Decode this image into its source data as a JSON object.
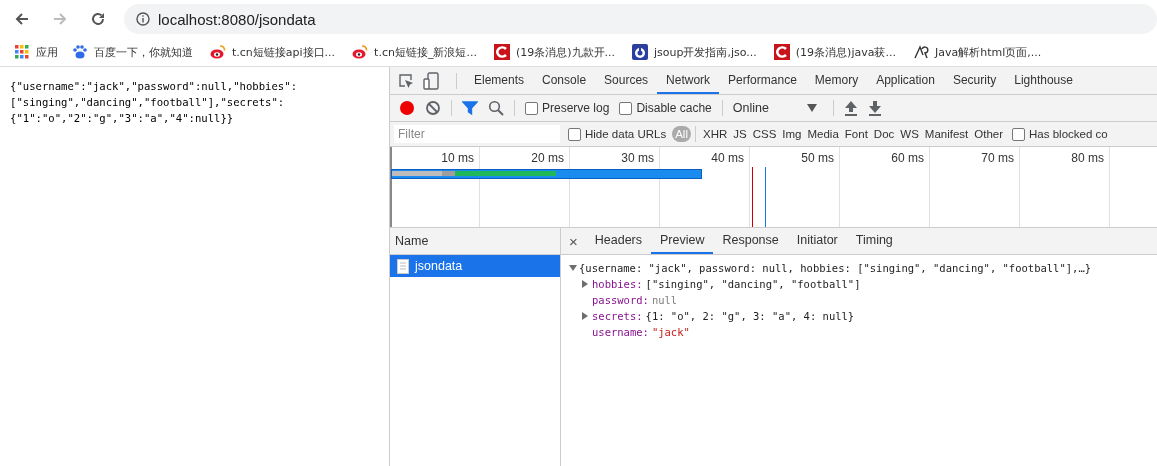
{
  "browser": {
    "address": "localhost:8080/jsondata",
    "back_disabled": false,
    "forward_disabled": true
  },
  "bookmarks": [
    {
      "kind": "apps",
      "label": "应用"
    },
    {
      "kind": "paw",
      "label": "百度一下，你就知道"
    },
    {
      "kind": "weibo",
      "label": "t.cn短链接api接口..."
    },
    {
      "kind": "weibo",
      "label": "t.cn短链接_新浪短..."
    },
    {
      "kind": "csdn",
      "label": "(19条消息)九款开..."
    },
    {
      "kind": "jsoup",
      "label": "jsoup开发指南,jso..."
    },
    {
      "kind": "csdn",
      "label": "(19条消息)java获..."
    },
    {
      "kind": "sketch",
      "label": "Java解析html页面,..."
    }
  ],
  "page": {
    "raw_lines": [
      "{\"username\":\"jack\",\"password\":null,\"hobbies\":",
      "[\"singing\",\"dancing\",\"football\"],\"secrets\":",
      "{\"1\":\"o\",\"2\":\"g\",\"3\":\"a\",\"4\":null}}"
    ]
  },
  "devtools": {
    "tabs": [
      {
        "label": "Elements",
        "selected": false
      },
      {
        "label": "Console",
        "selected": false
      },
      {
        "label": "Sources",
        "selected": false
      },
      {
        "label": "Network",
        "selected": true
      },
      {
        "label": "Performance",
        "selected": false
      },
      {
        "label": "Memory",
        "selected": false
      },
      {
        "label": "Application",
        "selected": false
      },
      {
        "label": "Security",
        "selected": false
      },
      {
        "label": "Lighthouse",
        "selected": false
      }
    ],
    "toolbar": {
      "recording": true,
      "filter_active": true,
      "preserve_log": {
        "label": "Preserve log",
        "checked": false
      },
      "disable_cache": {
        "label": "Disable cache",
        "checked": false
      },
      "throttling": "Online"
    },
    "filter_bar": {
      "placeholder": "Filter",
      "hide_data_urls": {
        "label": "Hide data URLs",
        "checked": false
      },
      "types": [
        {
          "label": "All",
          "selected": true
        },
        {
          "label": "XHR",
          "selected": false
        },
        {
          "label": "JS",
          "selected": false
        },
        {
          "label": "CSS",
          "selected": false
        },
        {
          "label": "Img",
          "selected": false
        },
        {
          "label": "Media",
          "selected": false
        },
        {
          "label": "Font",
          "selected": false
        },
        {
          "label": "Doc",
          "selected": false
        },
        {
          "label": "WS",
          "selected": false
        },
        {
          "label": "Manifest",
          "selected": false
        },
        {
          "label": "Other",
          "selected": false
        }
      ],
      "has_blocked": {
        "label": "Has blocked co",
        "checked": false
      }
    },
    "overview_ticks": [
      "10 ms",
      "20 ms",
      "30 ms",
      "40 ms",
      "50 ms",
      "60 ms",
      "70 ms",
      "80 ms"
    ],
    "requests": {
      "column": "Name",
      "rows": [
        {
          "name": "jsondata",
          "selected": true
        }
      ]
    },
    "detail_close": "×",
    "detail_tabs": [
      {
        "label": "Headers",
        "selected": false
      },
      {
        "label": "Preview",
        "selected": true
      },
      {
        "label": "Response",
        "selected": false
      },
      {
        "label": "Initiator",
        "selected": false
      },
      {
        "label": "Timing",
        "selected": false
      }
    ],
    "preview": {
      "summary": "{username: \"jack\", password: null, hobbies: [\"singing\", \"dancing\", \"football\"],…}",
      "expanded": true,
      "children": [
        {
          "key": "hobbies:",
          "value": "[\"singing\", \"dancing\", \"football\"]",
          "kind": "object",
          "expanded": false
        },
        {
          "key": "password:",
          "value": "null",
          "kind": "null"
        },
        {
          "key": "secrets:",
          "value": "{1: \"o\", 2: \"g\", 3: \"a\", 4: null}",
          "kind": "object",
          "expanded": false
        },
        {
          "key": "username:",
          "value": "\"jack\"",
          "kind": "string"
        }
      ]
    }
  }
}
